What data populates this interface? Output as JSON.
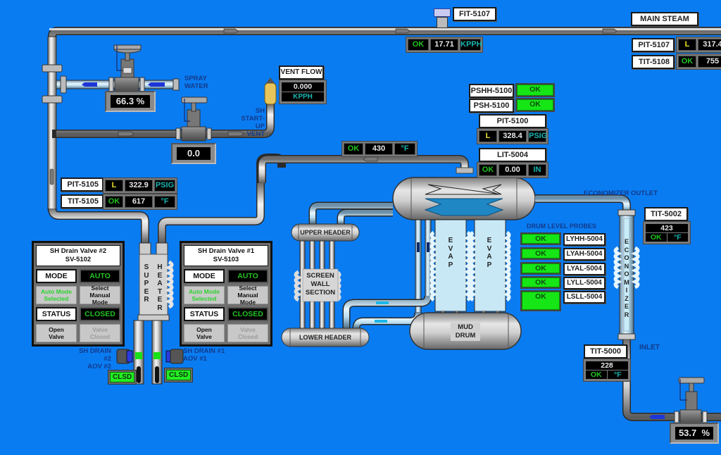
{
  "main_steam": {
    "title": "MAIN STEAM",
    "pit": {
      "tag": "PIT-5107",
      "status": "L",
      "value": "317.4"
    },
    "tit": {
      "tag": "TIT-5108",
      "status": "OK",
      "value": "755"
    }
  },
  "fit_5107": {
    "tag": "FIT-5107",
    "status": "OK",
    "value": "17.71",
    "unit": "KPPH"
  },
  "spray_water": {
    "label_line1": "SPRAY",
    "label_line2": "WATER",
    "valve_position": "66.3 %"
  },
  "startup_vent": {
    "label_line1": "SH",
    "label_line2": "START-UP",
    "label_line3": "VENT",
    "valve_position": "0.0"
  },
  "vent_flow": {
    "title": "VENT FLOW",
    "value": "0.000",
    "unit": "KPPH"
  },
  "pshh_5100": {
    "tag": "PSHH-5100",
    "status": "OK"
  },
  "psh_5100": {
    "tag": "PSH-5100",
    "status": "OK"
  },
  "pit_5100": {
    "tag": "PIT-5100",
    "status": "L",
    "value": "328.4",
    "unit": "PSIG"
  },
  "lit_5004": {
    "tag": "LIT-5004",
    "status": "OK",
    "value": "0.00",
    "unit": "IN"
  },
  "drum_inlet_temp": {
    "status": "OK",
    "value": "430",
    "unit": "°F"
  },
  "pit_5105": {
    "tag": "PIT-5105",
    "status": "L",
    "value": "322.9",
    "unit": "PSIG"
  },
  "tit_5105": {
    "tag": "TIT-5105",
    "status": "OK",
    "value": "617",
    "unit": "°F"
  },
  "sh_drain_valve_2": {
    "title_line1": "SH Drain Valve #2",
    "title_line2": "SV-5102",
    "mode_label": "MODE",
    "mode_value": "AUTO",
    "auto_btn_line1": "Auto Mode",
    "auto_btn_line2": "Selected",
    "manual_btn_line1": "Select Manual",
    "manual_btn_line2": "Mode",
    "status_label": "STATUS",
    "status_value": "CLOSED",
    "open_btn_line1": "Open",
    "open_btn_line2": "Valve",
    "closed_btn_line1": "Valve",
    "closed_btn_line2": "Closed"
  },
  "sh_drain_valve_1": {
    "title_line1": "SH Drain Valve #1",
    "title_line2": "SV-5103",
    "mode_label": "MODE",
    "mode_value": "AUTO",
    "auto_btn_line1": "Auto Mode",
    "auto_btn_line2": "Selected",
    "manual_btn_line1": "Select Manual",
    "manual_btn_line2": "Mode",
    "status_label": "STATUS",
    "status_value": "CLOSED",
    "open_btn_line1": "Open",
    "open_btn_line2": "Valve",
    "closed_btn_line1": "Valve",
    "closed_btn_line2": "Closed"
  },
  "superheater": {
    "letters_left": [
      "S",
      "U",
      "P",
      "E",
      "R"
    ],
    "letters_right": [
      "H",
      "E",
      "A",
      "T",
      "E",
      "R"
    ]
  },
  "sh_drain_aov_2": {
    "label_line1": "SH DRAIN #2",
    "label_line2": "AOV #2",
    "status": "CLSD"
  },
  "sh_drain_aov_1": {
    "label_line1": "SH DRAIN #1",
    "label_line2": "AOV #1",
    "status": "CLSD"
  },
  "upper_header": {
    "label": "UPPER HEADER"
  },
  "lower_header": {
    "label": "LOWER HEADER"
  },
  "screen_wall": {
    "line1": "SCREEN",
    "line2": "WALL",
    "line3": "SECTION"
  },
  "evap_letters": [
    "E",
    "V",
    "A",
    "P"
  ],
  "mud_drum": {
    "line1": "MUD",
    "line2": "DRUM"
  },
  "drum_level_probes": {
    "title": "DRUM LEVEL PROBES",
    "probes": [
      {
        "status": "OK",
        "tag": "LYHH-5004"
      },
      {
        "status": "OK",
        "tag": "LYAH-5004"
      },
      {
        "status": "OK",
        "tag": "LYAL-5004"
      },
      {
        "status": "OK",
        "tag": "LYLL-5004"
      },
      {
        "status": "OK",
        "tag": "LSLL-5004"
      }
    ]
  },
  "economizer": {
    "outlet_label": "ECONOMIZER OUTLET",
    "inlet_label": "INLET",
    "letters": [
      "E",
      "C",
      "O",
      "N",
      "O",
      "M",
      "I",
      "Z",
      "E",
      "R"
    ],
    "tit_5002": {
      "tag": "TIT-5002",
      "value": "423",
      "status": "OK",
      "unit": "°F"
    },
    "tit_5000": {
      "tag": "TIT-5000",
      "value": "228",
      "status": "OK",
      "unit": "°F"
    }
  },
  "feedwater_valve": {
    "valve_position": "53.7  %"
  },
  "colors": {
    "background": "#0a7cf2",
    "ok_green": "#16e516",
    "status_green_text": "#22c322",
    "warn_yellow": "#e8e02a",
    "unit_cyan": "#19b5b0"
  }
}
